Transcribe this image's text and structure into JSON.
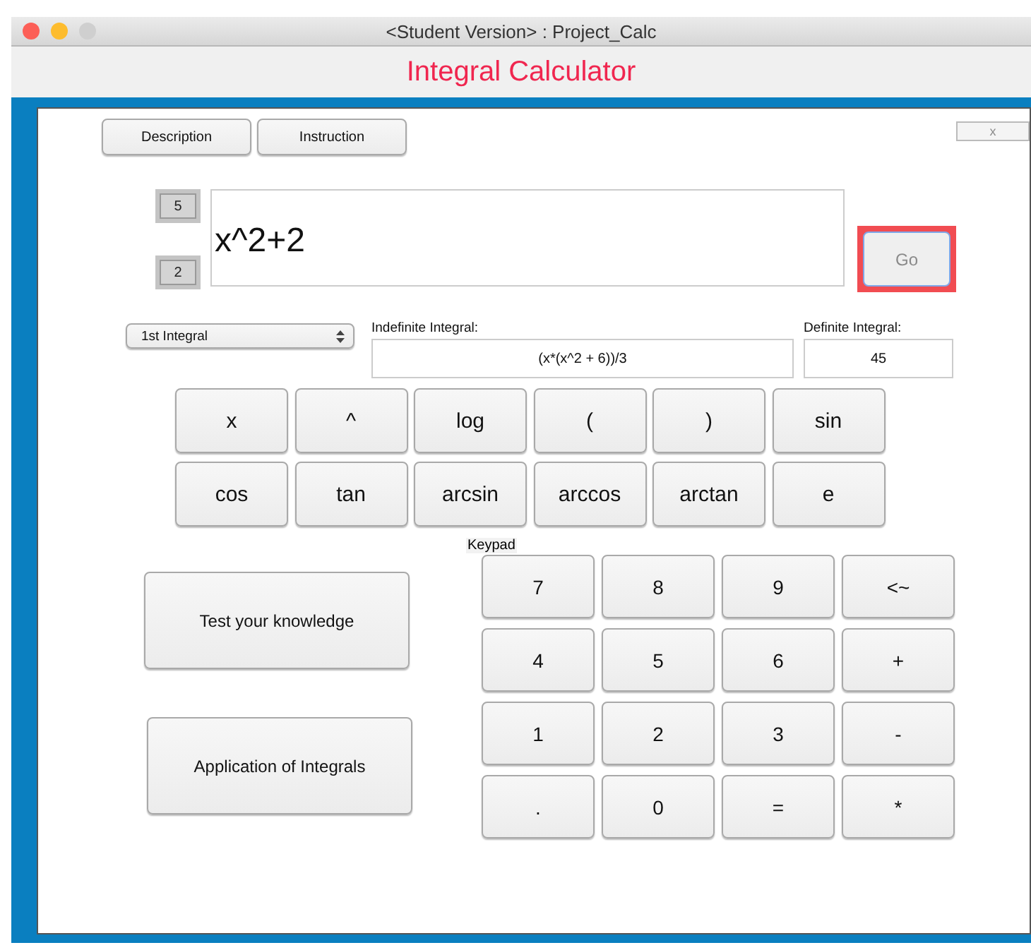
{
  "window": {
    "title": "<Student Version> : Project_Calc"
  },
  "header": "Integral Calculator",
  "top_buttons": [
    "Description",
    "Instruction"
  ],
  "close_button": "x",
  "bounds": {
    "upper": "5",
    "lower": "2"
  },
  "expression": {
    "value": "x^2+2"
  },
  "go_button": "Go",
  "integral_select": {
    "value": "1st Integral"
  },
  "indefinite": {
    "label": "Indefinite Integral:",
    "value": "(x*(x^2 + 6))/3"
  },
  "definite": {
    "label": "Definite Integral:",
    "value": "45"
  },
  "function_keys": [
    "x",
    "^",
    "log",
    "(",
    ")",
    "sin",
    "cos",
    "tan",
    "arcsin",
    "arccos",
    "arctan",
    "e"
  ],
  "side_buttons": [
    "Test your knowledge",
    "Application of Integrals"
  ],
  "keypad": {
    "label": "Keypad",
    "keys": [
      "7",
      "8",
      "9",
      "<~",
      "4",
      "5",
      "6",
      "+",
      "1",
      "2",
      "3",
      "-",
      ".",
      "0",
      "=",
      "*"
    ]
  }
}
